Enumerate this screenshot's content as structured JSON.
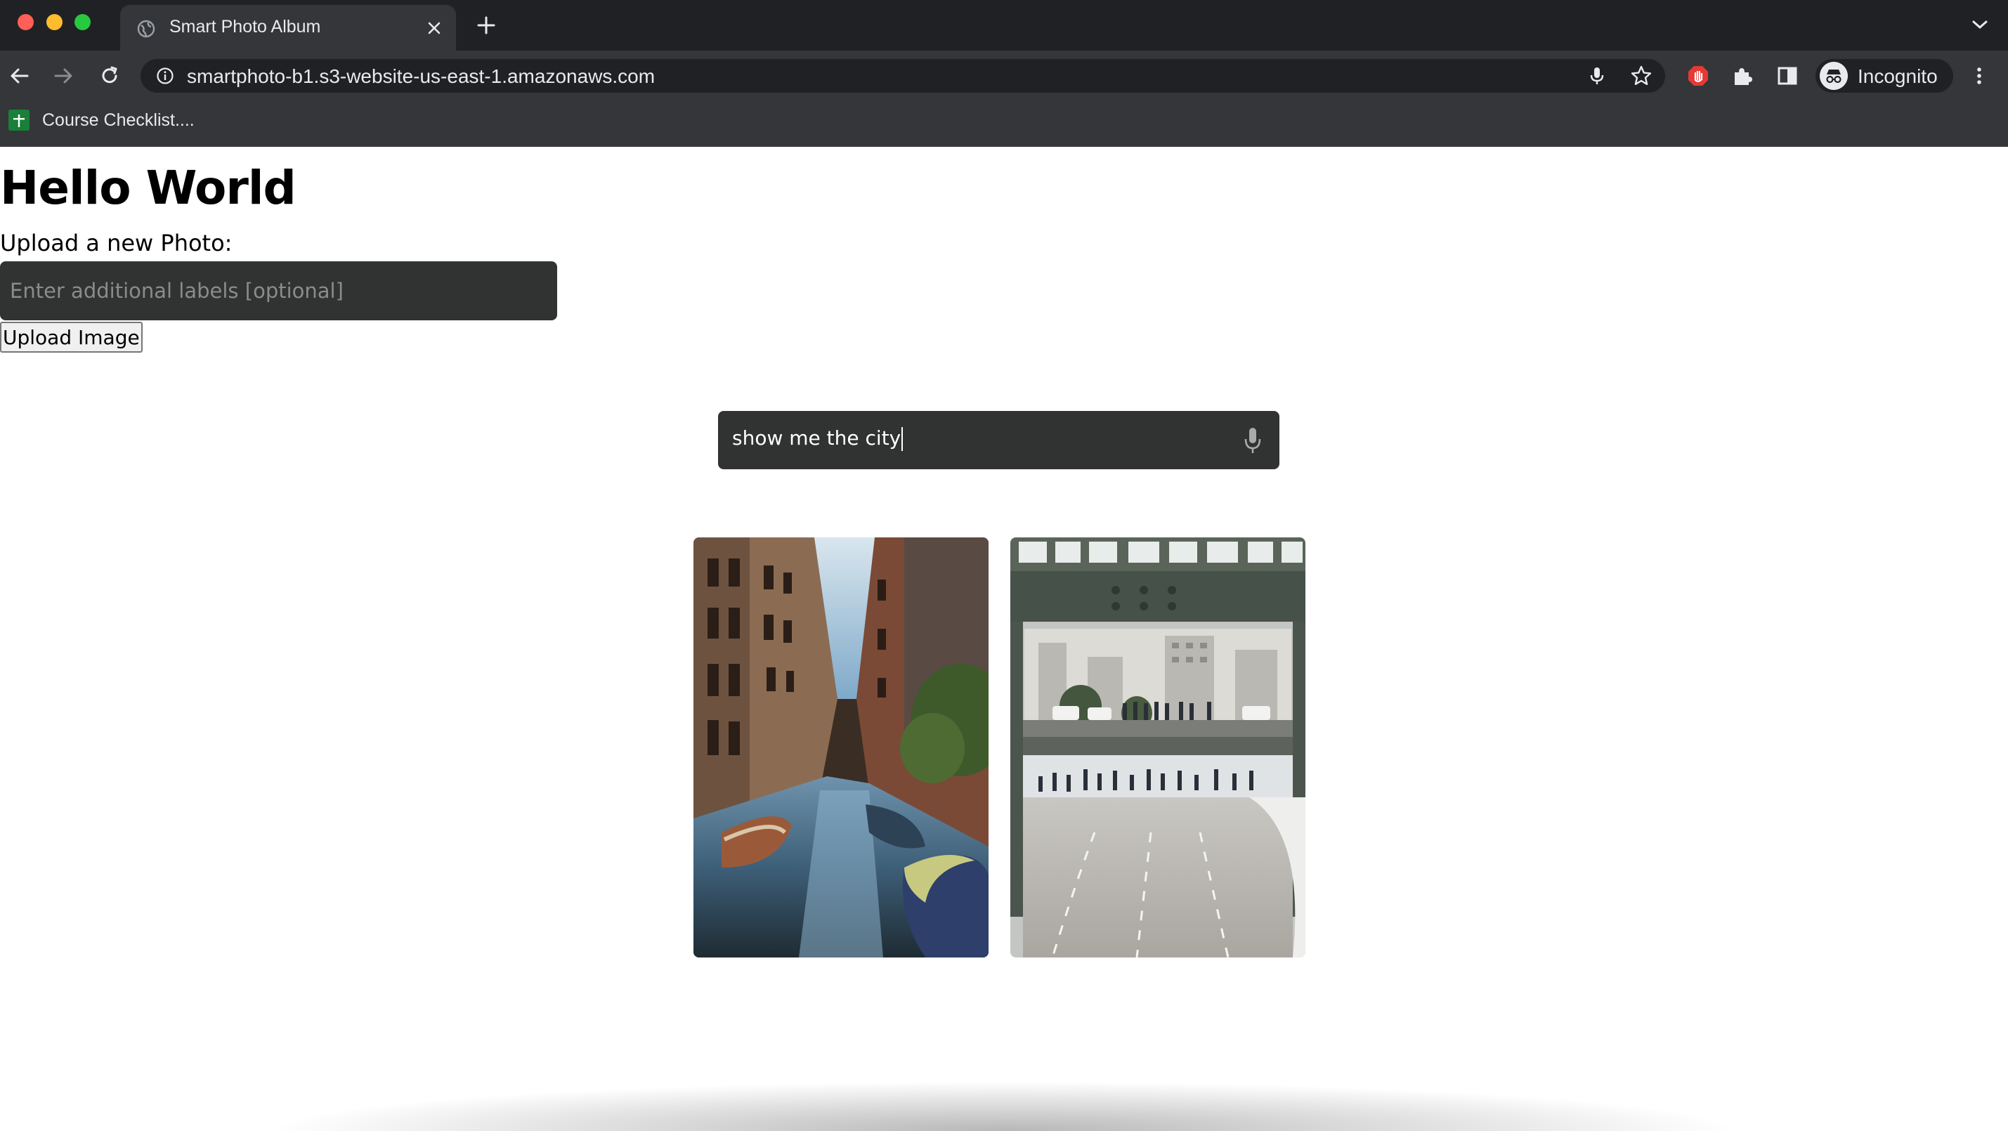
{
  "browser": {
    "tab": {
      "title": "Smart Photo Album"
    },
    "address_bar": {
      "url": "smartphoto-b1.s3-website-us-east-1.amazonaws.com"
    },
    "profile_label": "Incognito",
    "bookmarks": [
      {
        "label": "Course Checklist...."
      }
    ],
    "icons": [
      "globe-icon",
      "close-icon",
      "plus-icon",
      "chevron-down-icon",
      "back-arrow-icon",
      "forward-arrow-icon",
      "reload-icon",
      "info-icon",
      "microphone-icon",
      "star-icon",
      "adblock-icon",
      "puzzle-icon",
      "side-panel-icon",
      "incognito-icon",
      "more-vert-icon"
    ]
  },
  "page": {
    "heading": "Hello World",
    "upload": {
      "label": "Upload a new Photo:",
      "labels_input_placeholder": "Enter additional labels [optional]",
      "labels_input_value": "",
      "button_label": "Upload Image"
    },
    "search": {
      "query": "show me the city",
      "mic_icon": "microphone-icon"
    },
    "results": [
      {
        "alt": "venice-canal-photo"
      },
      {
        "alt": "city-overpass-crowd-photo"
      }
    ]
  },
  "colors": {
    "tabstrip_bg": "#202124",
    "toolbar_bg": "#35363a",
    "input_bg": "#313332",
    "page_bg": "#ffffff"
  }
}
